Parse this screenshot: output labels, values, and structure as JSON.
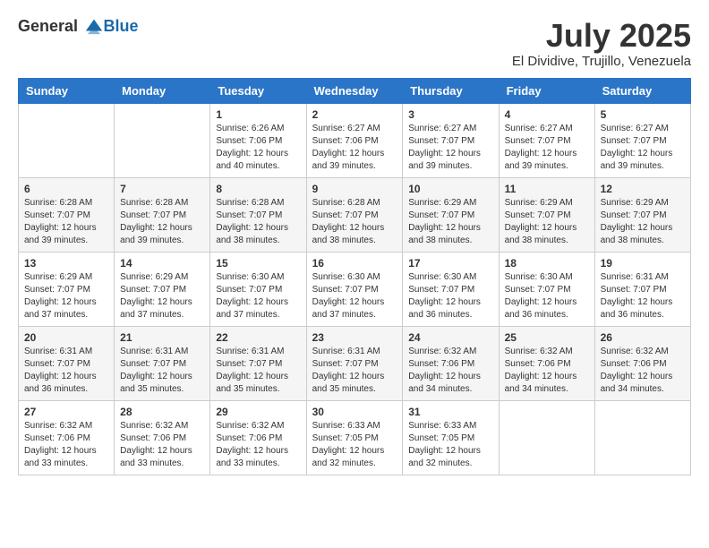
{
  "logo": {
    "general": "General",
    "blue": "Blue"
  },
  "header": {
    "month": "July 2025",
    "location": "El Dividive, Trujillo, Venezuela"
  },
  "weekdays": [
    "Sunday",
    "Monday",
    "Tuesday",
    "Wednesday",
    "Thursday",
    "Friday",
    "Saturday"
  ],
  "weeks": [
    [
      {
        "day": "",
        "sunrise": "",
        "sunset": "",
        "daylight": ""
      },
      {
        "day": "",
        "sunrise": "",
        "sunset": "",
        "daylight": ""
      },
      {
        "day": "1",
        "sunrise": "Sunrise: 6:26 AM",
        "sunset": "Sunset: 7:06 PM",
        "daylight": "Daylight: 12 hours and 40 minutes."
      },
      {
        "day": "2",
        "sunrise": "Sunrise: 6:27 AM",
        "sunset": "Sunset: 7:06 PM",
        "daylight": "Daylight: 12 hours and 39 minutes."
      },
      {
        "day": "3",
        "sunrise": "Sunrise: 6:27 AM",
        "sunset": "Sunset: 7:07 PM",
        "daylight": "Daylight: 12 hours and 39 minutes."
      },
      {
        "day": "4",
        "sunrise": "Sunrise: 6:27 AM",
        "sunset": "Sunset: 7:07 PM",
        "daylight": "Daylight: 12 hours and 39 minutes."
      },
      {
        "day": "5",
        "sunrise": "Sunrise: 6:27 AM",
        "sunset": "Sunset: 7:07 PM",
        "daylight": "Daylight: 12 hours and 39 minutes."
      }
    ],
    [
      {
        "day": "6",
        "sunrise": "Sunrise: 6:28 AM",
        "sunset": "Sunset: 7:07 PM",
        "daylight": "Daylight: 12 hours and 39 minutes."
      },
      {
        "day": "7",
        "sunrise": "Sunrise: 6:28 AM",
        "sunset": "Sunset: 7:07 PM",
        "daylight": "Daylight: 12 hours and 39 minutes."
      },
      {
        "day": "8",
        "sunrise": "Sunrise: 6:28 AM",
        "sunset": "Sunset: 7:07 PM",
        "daylight": "Daylight: 12 hours and 38 minutes."
      },
      {
        "day": "9",
        "sunrise": "Sunrise: 6:28 AM",
        "sunset": "Sunset: 7:07 PM",
        "daylight": "Daylight: 12 hours and 38 minutes."
      },
      {
        "day": "10",
        "sunrise": "Sunrise: 6:29 AM",
        "sunset": "Sunset: 7:07 PM",
        "daylight": "Daylight: 12 hours and 38 minutes."
      },
      {
        "day": "11",
        "sunrise": "Sunrise: 6:29 AM",
        "sunset": "Sunset: 7:07 PM",
        "daylight": "Daylight: 12 hours and 38 minutes."
      },
      {
        "day": "12",
        "sunrise": "Sunrise: 6:29 AM",
        "sunset": "Sunset: 7:07 PM",
        "daylight": "Daylight: 12 hours and 38 minutes."
      }
    ],
    [
      {
        "day": "13",
        "sunrise": "Sunrise: 6:29 AM",
        "sunset": "Sunset: 7:07 PM",
        "daylight": "Daylight: 12 hours and 37 minutes."
      },
      {
        "day": "14",
        "sunrise": "Sunrise: 6:29 AM",
        "sunset": "Sunset: 7:07 PM",
        "daylight": "Daylight: 12 hours and 37 minutes."
      },
      {
        "day": "15",
        "sunrise": "Sunrise: 6:30 AM",
        "sunset": "Sunset: 7:07 PM",
        "daylight": "Daylight: 12 hours and 37 minutes."
      },
      {
        "day": "16",
        "sunrise": "Sunrise: 6:30 AM",
        "sunset": "Sunset: 7:07 PM",
        "daylight": "Daylight: 12 hours and 37 minutes."
      },
      {
        "day": "17",
        "sunrise": "Sunrise: 6:30 AM",
        "sunset": "Sunset: 7:07 PM",
        "daylight": "Daylight: 12 hours and 36 minutes."
      },
      {
        "day": "18",
        "sunrise": "Sunrise: 6:30 AM",
        "sunset": "Sunset: 7:07 PM",
        "daylight": "Daylight: 12 hours and 36 minutes."
      },
      {
        "day": "19",
        "sunrise": "Sunrise: 6:31 AM",
        "sunset": "Sunset: 7:07 PM",
        "daylight": "Daylight: 12 hours and 36 minutes."
      }
    ],
    [
      {
        "day": "20",
        "sunrise": "Sunrise: 6:31 AM",
        "sunset": "Sunset: 7:07 PM",
        "daylight": "Daylight: 12 hours and 36 minutes."
      },
      {
        "day": "21",
        "sunrise": "Sunrise: 6:31 AM",
        "sunset": "Sunset: 7:07 PM",
        "daylight": "Daylight: 12 hours and 35 minutes."
      },
      {
        "day": "22",
        "sunrise": "Sunrise: 6:31 AM",
        "sunset": "Sunset: 7:07 PM",
        "daylight": "Daylight: 12 hours and 35 minutes."
      },
      {
        "day": "23",
        "sunrise": "Sunrise: 6:31 AM",
        "sunset": "Sunset: 7:07 PM",
        "daylight": "Daylight: 12 hours and 35 minutes."
      },
      {
        "day": "24",
        "sunrise": "Sunrise: 6:32 AM",
        "sunset": "Sunset: 7:06 PM",
        "daylight": "Daylight: 12 hours and 34 minutes."
      },
      {
        "day": "25",
        "sunrise": "Sunrise: 6:32 AM",
        "sunset": "Sunset: 7:06 PM",
        "daylight": "Daylight: 12 hours and 34 minutes."
      },
      {
        "day": "26",
        "sunrise": "Sunrise: 6:32 AM",
        "sunset": "Sunset: 7:06 PM",
        "daylight": "Daylight: 12 hours and 34 minutes."
      }
    ],
    [
      {
        "day": "27",
        "sunrise": "Sunrise: 6:32 AM",
        "sunset": "Sunset: 7:06 PM",
        "daylight": "Daylight: 12 hours and 33 minutes."
      },
      {
        "day": "28",
        "sunrise": "Sunrise: 6:32 AM",
        "sunset": "Sunset: 7:06 PM",
        "daylight": "Daylight: 12 hours and 33 minutes."
      },
      {
        "day": "29",
        "sunrise": "Sunrise: 6:32 AM",
        "sunset": "Sunset: 7:06 PM",
        "daylight": "Daylight: 12 hours and 33 minutes."
      },
      {
        "day": "30",
        "sunrise": "Sunrise: 6:33 AM",
        "sunset": "Sunset: 7:05 PM",
        "daylight": "Daylight: 12 hours and 32 minutes."
      },
      {
        "day": "31",
        "sunrise": "Sunrise: 6:33 AM",
        "sunset": "Sunset: 7:05 PM",
        "daylight": "Daylight: 12 hours and 32 minutes."
      },
      {
        "day": "",
        "sunrise": "",
        "sunset": "",
        "daylight": ""
      },
      {
        "day": "",
        "sunrise": "",
        "sunset": "",
        "daylight": ""
      }
    ]
  ]
}
